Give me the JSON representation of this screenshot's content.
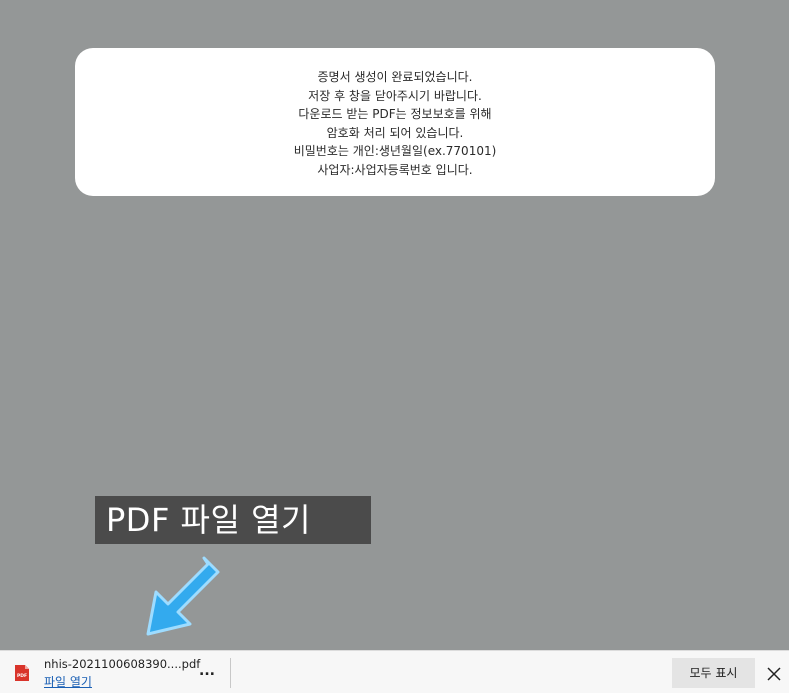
{
  "message": {
    "lines": [
      "증명서 생성이 완료되었습니다.",
      "저장 후 창을 닫아주시기 바랍니다.",
      "다운로드 받는 PDF는 정보보호를 위해",
      "암호화 처리 되어 있습니다.",
      "비밀번호는 개인:생년월일(ex.770101)",
      "사업자:사업자등록번호 입니다."
    ]
  },
  "callout": {
    "label": "PDF 파일 열기",
    "arrow_icon": "arrow-down-left-icon",
    "arrow_color": "#33aaee"
  },
  "download_bar": {
    "file_icon": "pdf-file-icon",
    "file_name": "nhis-2021100608390....pdf",
    "open_label": "파일 열기",
    "more_label": "...",
    "show_all_label": "모두 표시",
    "close_icon": "close-icon"
  },
  "colors": {
    "backdrop": "#949797",
    "card": "#ffffff",
    "callout_bg": "#4b4b4b",
    "pdf_icon": "#d9342b",
    "link": "#1a5fb4"
  }
}
